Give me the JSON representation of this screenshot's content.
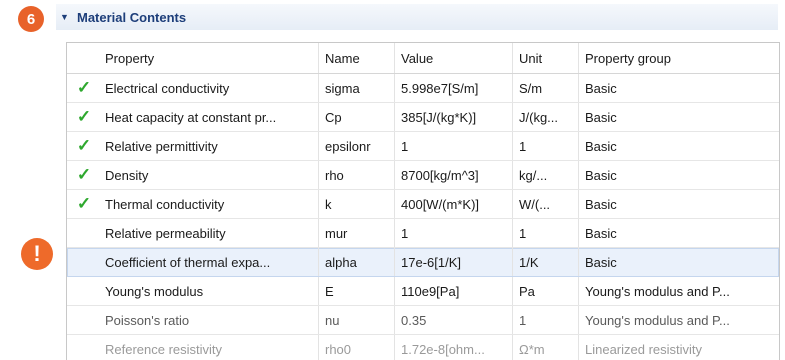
{
  "step_badge": "6",
  "warning_badge": "!",
  "section": {
    "title": "Material Contents"
  },
  "columns": [
    "Property",
    "Name",
    "Value",
    "Unit",
    "Property group"
  ],
  "rows": [
    {
      "check": true,
      "property": "Electrical conductivity",
      "name": "sigma",
      "value": "5.998e7[S/m]",
      "unit": "S/m",
      "group": "Basic"
    },
    {
      "check": true,
      "property": "Heat capacity at constant pr...",
      "name": "Cp",
      "value": "385[J/(kg*K)]",
      "unit": "J/(kg...",
      "group": "Basic"
    },
    {
      "check": true,
      "property": "Relative permittivity",
      "name": "epsilonr",
      "value": "1",
      "unit": "1",
      "group": "Basic"
    },
    {
      "check": true,
      "property": "Density",
      "name": "rho",
      "value": "8700[kg/m^3]",
      "unit": "kg/...",
      "group": "Basic"
    },
    {
      "check": true,
      "property": "Thermal conductivity",
      "name": "k",
      "value": "400[W/(m*K)]",
      "unit": "W/(...",
      "group": "Basic"
    },
    {
      "check": false,
      "property": "Relative permeability",
      "name": "mur",
      "value": "1",
      "unit": "1",
      "group": "Basic"
    },
    {
      "check": false,
      "property": "Coefficient of thermal expa...",
      "name": "alpha",
      "value": "17e-6[1/K]",
      "unit": "1/K",
      "group": "Basic"
    },
    {
      "check": false,
      "property": "Young's modulus",
      "name": "E",
      "value": "110e9[Pa]",
      "unit": "Pa",
      "group": "Young's modulus and P..."
    },
    {
      "check": false,
      "property": "Poisson's ratio",
      "name": "nu",
      "value": "0.35",
      "unit": "1",
      "group": "Young's modulus and P..."
    },
    {
      "check": false,
      "property": "Reference resistivity",
      "name": "rho0",
      "value": "1.72e-8[ohm...",
      "unit": "Ω*m",
      "group": "Linearized resistivity"
    }
  ],
  "icons": {
    "check": "✓",
    "toggle": "▼"
  },
  "colors": {
    "check": "#2ea82e",
    "badge": "#e8622a",
    "header_text": "#1d3e7a"
  }
}
